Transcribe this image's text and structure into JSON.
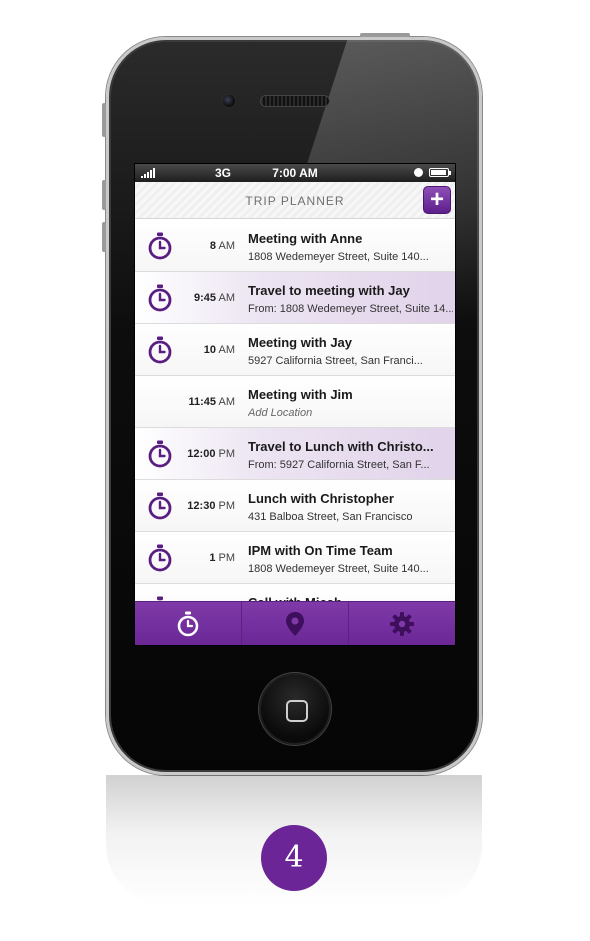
{
  "status_bar": {
    "carrier": "3G",
    "time": "7:00 AM"
  },
  "nav": {
    "title": "TRIP PLANNER",
    "add_label": "+"
  },
  "colors": {
    "accent": "#6b2596",
    "travel_row": "#e1d3ea"
  },
  "items": [
    {
      "time": "8",
      "ampm": "AM",
      "title": "Meeting with Anne",
      "subtitle": "1808 Wedemeyer Street, Suite 140...",
      "kind": "meeting",
      "icon": "stopwatch-icon"
    },
    {
      "time": "9:45",
      "ampm": "AM",
      "title": "Travel to meeting with Jay",
      "subtitle": "From: 1808 Wedemeyer Street, Suite 14...",
      "kind": "travel",
      "icon": "stopwatch-icon"
    },
    {
      "time": "10",
      "ampm": "AM",
      "title": "Meeting with Jay",
      "subtitle": "5927 California Street, San Franci...",
      "kind": "meeting",
      "icon": "stopwatch-icon"
    },
    {
      "time": "11:45",
      "ampm": "AM",
      "title": "Meeting with Jim",
      "subtitle": "Add Location",
      "kind": "meeting",
      "placeholder": true
    },
    {
      "time": "12:00",
      "ampm": "PM",
      "title": "Travel to Lunch with Christo...",
      "subtitle": "From: 5927 California Street, San F...",
      "kind": "travel",
      "icon": "stopwatch-icon"
    },
    {
      "time": "12:30",
      "ampm": "PM",
      "title": "Lunch with Christopher",
      "subtitle": "431 Balboa Street, San Francisco",
      "kind": "meeting",
      "icon": "stopwatch-icon"
    },
    {
      "time": "1",
      "ampm": "PM",
      "title": "IPM with On Time Team",
      "subtitle": "1808 Wedemeyer Street, Suite 140...",
      "kind": "meeting",
      "icon": "stopwatch-icon"
    },
    {
      "time": "",
      "ampm": "",
      "title": "Call with Micah",
      "subtitle": "",
      "kind": "meeting",
      "icon": "stopwatch-icon"
    }
  ],
  "tabs": [
    {
      "icon": "stopwatch-icon"
    },
    {
      "icon": "map-pin-icon"
    },
    {
      "icon": "gear-icon"
    }
  ],
  "step_badge": "4"
}
